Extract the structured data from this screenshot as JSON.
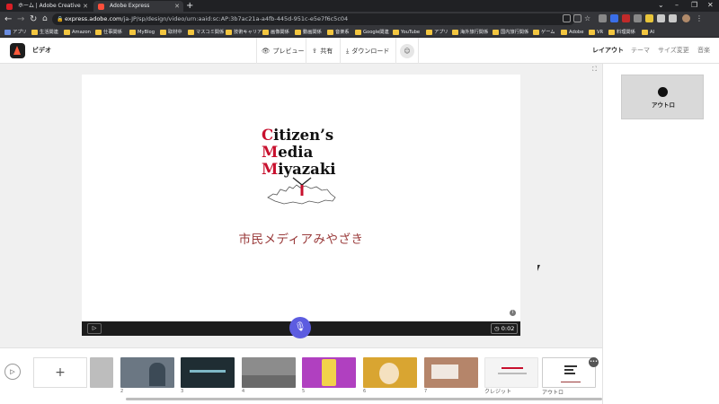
{
  "browser": {
    "tabs": [
      {
        "title": "ホーム | Adobe Creative Cloud",
        "active": false
      },
      {
        "title": "Adobe Express",
        "active": true
      }
    ],
    "new_tab": "+",
    "url_host": "express.adobe.com",
    "url_path": "/ja-JP/sp/design/video/urn:aaid:sc:AP:3b7ac21a-a4fb-445d-951c-e5e7f6c5c04",
    "bookmarks": [
      "アプリ",
      "生活関連",
      "Amazon",
      "仕事関係",
      "MyBlog",
      "取材中",
      "マスコミ関係",
      "技術キャリア",
      "画像関係",
      "動画関係",
      "音楽系",
      "Google関連",
      "YouTube",
      "アプリ",
      "海外旅行関係",
      "国内旅行関係",
      "ゲーム",
      "Adobe",
      "VR",
      "料理関係",
      "AI"
    ]
  },
  "header": {
    "title": "ビデオ",
    "preview_label": "プレビュー",
    "share_label": "共有",
    "download_label": "ダウンロード",
    "tabs": [
      "レイアウト",
      "テーマ",
      "サイズ変更",
      "音楽"
    ]
  },
  "slide": {
    "logo_lines": [
      {
        "first": "C",
        "rest": "itizen’s"
      },
      {
        "first": "M",
        "rest": "edia"
      },
      {
        "first": "M",
        "rest": "iyazaki"
      }
    ],
    "subtitle": "市民メディアみやざき"
  },
  "player": {
    "duration": "0:02"
  },
  "right_panel": {
    "layout_label": "アウトロ"
  },
  "timeline": {
    "add_label": "+",
    "scenes": [
      {
        "num": "",
        "color": "#bdbdbd"
      },
      {
        "num": "2",
        "color": "#6b7783"
      },
      {
        "num": "3",
        "color": "#1f2d33"
      },
      {
        "num": "4",
        "color": "#8c8c8c"
      },
      {
        "num": "5",
        "color": "#b040c0"
      },
      {
        "num": "6",
        "color": "#d9a531"
      },
      {
        "num": "7",
        "color": "#b5856a"
      }
    ],
    "credit_label": "クレジット",
    "outro_label": "アウトロ"
  },
  "colors": {
    "accent_mic": "#5c5ce0",
    "logo_red": "#c8102e",
    "subtitle": "#9a3b3b"
  }
}
